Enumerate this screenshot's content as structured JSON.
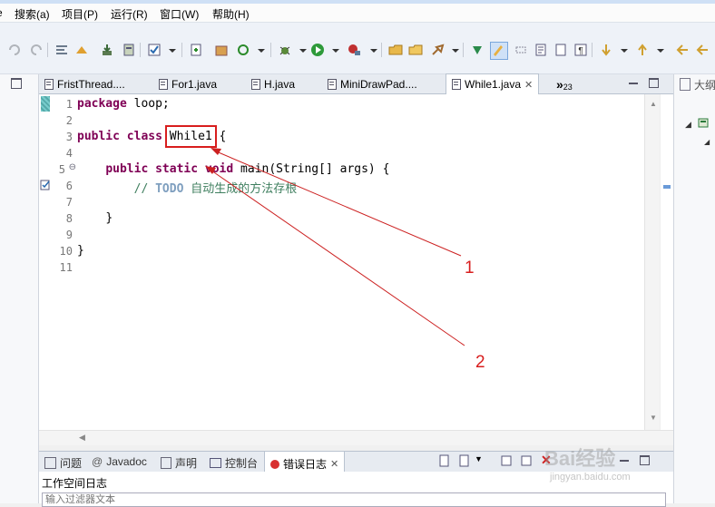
{
  "menu": [
    "搜索(a)",
    "项目(P)",
    "运行(R)",
    "窗口(W)",
    "帮助(H)"
  ],
  "editor_tabs": [
    {
      "label": "FristThread....",
      "active": false
    },
    {
      "label": "For1.java",
      "active": false
    },
    {
      "label": "H.java",
      "active": false
    },
    {
      "label": "MiniDrawPad....",
      "active": false
    },
    {
      "label": "While1.java",
      "active": true
    }
  ],
  "overflow_tab": {
    "chevron": "»",
    "count": "23"
  },
  "code": {
    "line_numbers": [
      "1",
      "2",
      "3",
      "4",
      "5",
      "6",
      "7",
      "8",
      "9",
      "10",
      "11"
    ],
    "l1_kw": "package",
    "l1_rest": " loop;",
    "l3_kw1": "public",
    "l3_kw2": "class",
    "l3_name": "While1",
    "l3_rest": " {",
    "l5_kw1": "public",
    "l5_kw2": "static",
    "l5_kw3": "void",
    "l5_rest": " main(String[] args) {",
    "l6_comment": "// ",
    "l6_todo": "TODO",
    "l6_text": " 自动生成的方法存根",
    "l8": "}",
    "l10": "}"
  },
  "bottom_tabs": [
    "问题",
    "Javadoc",
    "声明",
    "控制台",
    "错误日志"
  ],
  "active_bottom_tab": "错误日志",
  "bottom_panel": {
    "heading": "工作空间日志",
    "filter_placeholder": "输入过滤器文本"
  },
  "right_pane_label": "大纲",
  "annotations": [
    "1",
    "2"
  ],
  "watermark": {
    "line1": "Bai经验",
    "line2": "jingyan.baidu.com"
  },
  "colors": {
    "keyword": "#7f0055",
    "comment": "#3f7f5f",
    "annotation": "#d81e1e"
  }
}
